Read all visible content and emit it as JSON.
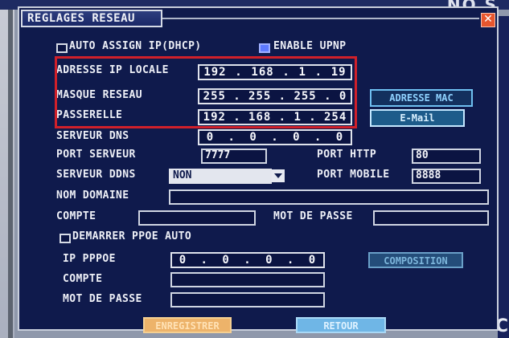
{
  "background": {
    "top_right_text": "NO S",
    "right_edge_text": "C"
  },
  "window": {
    "title": "REGLAGES RESEAU",
    "close_glyph": "✕"
  },
  "options": {
    "auto_assign_label": "AUTO ASSIGN IP(DHCP)",
    "auto_assign_checked": false,
    "enable_upnp_label": "ENABLE UPNP",
    "enable_upnp_checked": true
  },
  "network": {
    "local_ip_label": "ADRESSE IP LOCALE",
    "local_ip": [
      "192",
      "168",
      "1",
      "19"
    ],
    "subnet_label": "MASQUE RESEAU",
    "subnet": [
      "255",
      "255",
      "255",
      "0"
    ],
    "gateway_label": "PASSERELLE",
    "gateway": [
      "192",
      "168",
      "1",
      "254"
    ],
    "dns_label": "SERVEUR DNS",
    "dns": [
      "0",
      "0",
      "0",
      "0"
    ],
    "mac_button": "ADRESSE MAC",
    "email_button": "E-Mail"
  },
  "ports": {
    "server_port_label": "PORT SERVEUR",
    "server_port": "7777",
    "http_port_label": "PORT HTTP",
    "http_port": "80",
    "ddns_label": "SERVEUR DDNS",
    "ddns_value": "NON",
    "mobile_port_label": "PORT MOBILE",
    "mobile_port": "8888"
  },
  "ddns": {
    "domain_label": "NOM DOMAINE",
    "domain_value": "",
    "account_label": "COMPTE",
    "account_value": "",
    "password_label": "MOT DE PASSE",
    "password_value": ""
  },
  "pppoe": {
    "auto_start_label": "DEMARRER PPOE AUTO",
    "auto_start_checked": false,
    "ip_label": "IP PPPOE",
    "ip": [
      "0",
      "0",
      "0",
      "0"
    ],
    "composition_button": "COMPOSITION",
    "account_label": "COMPTE",
    "account_value": "",
    "password_label": "MOT DE PASSE",
    "password_value": ""
  },
  "footer": {
    "save_button": "ENREGISTRER",
    "back_button": "RETOUR"
  }
}
